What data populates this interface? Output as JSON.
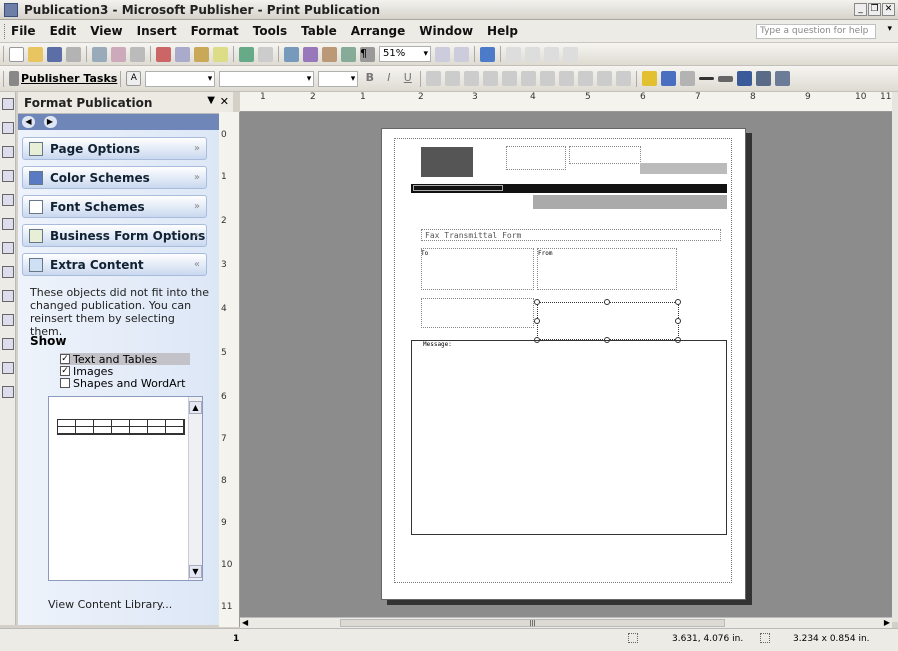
{
  "window": {
    "title": "Publication3 - Microsoft Publisher - Print Publication"
  },
  "menubar": {
    "items": [
      "File",
      "Edit",
      "View",
      "Insert",
      "Format",
      "Tools",
      "Table",
      "Arrange",
      "Window",
      "Help"
    ],
    "help_placeholder": "Type a question for help"
  },
  "toolbar": {
    "zoom": "51%",
    "publisher_tasks": "Publisher Tasks"
  },
  "taskpane": {
    "title": "Format Publication",
    "sections": [
      {
        "label": "Page Options",
        "icon": "page-icon"
      },
      {
        "label": "Color Schemes",
        "icon": "color-scheme-icon"
      },
      {
        "label": "Font Schemes",
        "icon": "font-icon"
      },
      {
        "label": "Business Form Options",
        "icon": "form-icon"
      },
      {
        "label": "Extra Content",
        "icon": "extra-content-icon"
      }
    ],
    "info": "These objects did not fit into the changed publication. You can reinsert them by selecting them.",
    "show_label": "Show",
    "checkboxes": [
      {
        "label": "Text and Tables",
        "checked": true
      },
      {
        "label": "Images",
        "checked": true
      },
      {
        "label": "Shapes and WordArt",
        "checked": false
      }
    ],
    "library_link": "View Content Library..."
  },
  "document": {
    "fax_title": "Fax Transmittal Form",
    "to_label": "To",
    "from_label": "From",
    "message_label": "Message:"
  },
  "ruler": {
    "top_numbers": [
      "1",
      "2",
      "1",
      "2",
      "3",
      "4",
      "5",
      "6",
      "7",
      "8",
      "9",
      "10",
      "11"
    ],
    "left_numbers": [
      "0",
      "1",
      "2",
      "3",
      "4",
      "5",
      "6",
      "7",
      "8",
      "9",
      "10",
      "11"
    ]
  },
  "statusbar": {
    "page": "1",
    "position": "3.631, 4.076 in.",
    "size": "3.234 x 0.854 in."
  }
}
